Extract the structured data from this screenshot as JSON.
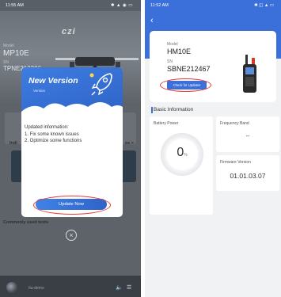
{
  "left": {
    "status": {
      "time": "11:55 AM",
      "icons_left": "⎈ ⎈",
      "icons_right": "✱  \u0001  ■"
    },
    "brand": "czi",
    "hero": {
      "model_label": "Model",
      "model_value": "MP10E",
      "sn_label": "SN",
      "sn_value": "TPNE212306"
    },
    "modal": {
      "title": "New Version",
      "version_label": "Version",
      "body_title": "Updated information:",
      "items": [
        "1. Fix some known issues",
        "2. Optimize some functions"
      ],
      "button": "Update Now"
    },
    "bg_text": {
      "indi": "Indi",
      "es": "es >",
      "common": "Commonly used texts"
    },
    "bottom": {
      "name": "Itu-demo"
    }
  },
  "right": {
    "status": {
      "time": "11:52 AM",
      "icons_right": "✱ ▣  ■"
    },
    "device": {
      "model_label": "Model",
      "model_value": "HM10E",
      "sn_label": "SN",
      "sn_value": "SBNE212467",
      "check_button": "Check for Updates"
    },
    "section_title": "Basic Information",
    "battery": {
      "label": "Battery Power",
      "value": "0",
      "unit": "%"
    },
    "frequency": {
      "label": "Frequency Band",
      "value": "--"
    },
    "firmware": {
      "label": "Firmware Version",
      "value": "01.01.03.07"
    }
  }
}
